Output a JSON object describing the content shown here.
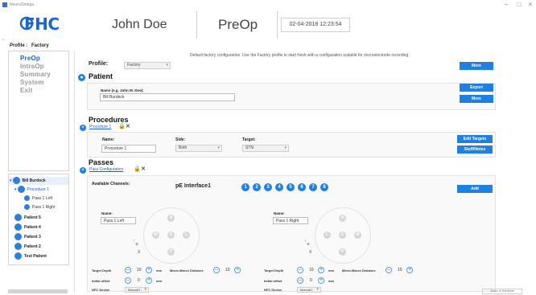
{
  "window": {
    "title": "NeuroOmega"
  },
  "header": {
    "logo": "FHC",
    "user_name": "John Doe",
    "mode": "PreOp",
    "datetime": "02-04-2018 12:23:54"
  },
  "sidebar": {
    "profile_label": "Profile :",
    "profile_value": "Factory",
    "nav": [
      "PreOp",
      "IntraOp",
      "Summary",
      "System",
      "Exit"
    ],
    "active": "PreOp"
  },
  "tree": {
    "items": [
      {
        "label": "Bill Burdeck",
        "level": 0
      },
      {
        "label": "Procedure 1",
        "level": 1
      },
      {
        "label": "Pass 1 Left",
        "level": 2
      },
      {
        "label": "Pass 1 Right",
        "level": 2
      },
      {
        "label": "Patient 5",
        "level": 0
      },
      {
        "label": "Patient 4",
        "level": 0
      },
      {
        "label": "Patient 3",
        "level": 0
      },
      {
        "label": "Patient 2",
        "level": 0
      },
      {
        "label": "Test Patient",
        "level": 0
      }
    ]
  },
  "main": {
    "profile": {
      "label": "Profile:",
      "value": "Factory",
      "description": "Default factory configuration. Use the Factory profile to start fresh with a configuration suitable for microelectrode recording.",
      "more_button": "More"
    },
    "patient": {
      "title": "Patient",
      "name_label": "Name (e.g. John M. Doe):",
      "name_value": "Bill Burdeck",
      "export_button": "Export",
      "more_button": "More"
    },
    "procedures": {
      "title": "Procedures",
      "tab_link": "Procedure 1",
      "name_label": "Name:",
      "name_value": "Procedure 1",
      "side_label": "Side:",
      "side_value": "Both",
      "target_label": "Target:",
      "target_value": "STN",
      "edit_targets_button": "Edit Targets",
      "stuff_notes_button": "Stuff/Notes"
    },
    "passes": {
      "title": "Passes",
      "tab_link": "Pass Configuration",
      "available_channels_label": "Available Channels:",
      "interface_label": "pE Interface1",
      "channels": [
        "1",
        "2",
        "3",
        "4",
        "5",
        "6",
        "7",
        "8"
      ],
      "add_button": "Add",
      "left": {
        "name_label": "Name:",
        "name_value": "Pass 1 Left",
        "target_depth_label": "Target Depth",
        "target_depth_value": "10",
        "unit": "mm",
        "micro_distance_label": "Micro-Macro Distance",
        "micro_distance_value": "10",
        "initial_offset_label": "Initial offset",
        "initial_offset_value": "0",
        "nfc_device_label": "NFC Device",
        "nfc_device_value": "Manual1"
      },
      "right": {
        "name_label": "Name:",
        "name_value": "Pass 1 Right",
        "target_depth_label": "Target Depth",
        "target_depth_value": "10",
        "unit": "mm",
        "micro_distance_label": "Micro-Macro Distance",
        "micro_distance_value": "10",
        "initial_offset_label": "Initial offset",
        "initial_offset_value": "0",
        "nfc_device_label": "NFC Device",
        "nfc_device_value": "Manual1"
      },
      "ring_letters": [
        "A",
        "P",
        "C",
        "M",
        "L"
      ],
      "orient": {
        "plus": "+",
        "x": "X",
        "arrow": "↑"
      }
    }
  },
  "status": {
    "text": "Status of Hardware"
  },
  "colors": {
    "accent": "#1f80e0",
    "logo": "#1b66c9"
  }
}
